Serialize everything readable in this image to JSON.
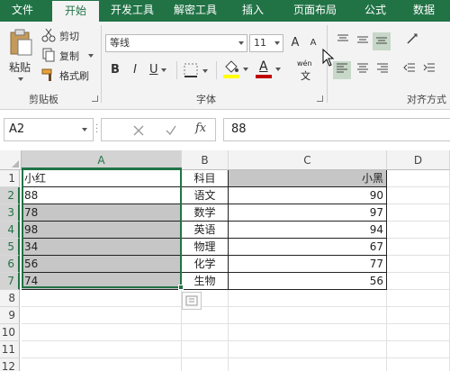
{
  "tabs": [
    {
      "label": "文件",
      "active": false
    },
    {
      "label": "开始",
      "active": true
    },
    {
      "label": "开发工具",
      "active": false
    },
    {
      "label": "解密工具",
      "active": false
    },
    {
      "label": "插入",
      "active": false
    },
    {
      "label": "页面布局",
      "active": false
    },
    {
      "label": "公式",
      "active": false
    },
    {
      "label": "数据",
      "active": false
    }
  ],
  "clipboard": {
    "paste": "粘贴",
    "cut": "剪切",
    "copy": "复制",
    "format_painter": "格式刷",
    "group": "剪贴板"
  },
  "font": {
    "name": "等线",
    "size": "11",
    "bold": "B",
    "italic": "I",
    "underline": "U",
    "grow": "A",
    "shrink": "A",
    "phonetic": "wén",
    "color_letter": "A",
    "group": "字体"
  },
  "alignment": {
    "group": "对齐方式"
  },
  "name_box": "A2",
  "formula_value": "88",
  "colors": {
    "accent": "#217346",
    "fill_yellow": "#ffff00",
    "font_red": "#c00000"
  },
  "columns": [
    "A",
    "B",
    "C",
    "D"
  ],
  "rows": [
    "1",
    "2",
    "3",
    "4",
    "5",
    "6",
    "7",
    "8",
    "9",
    "10",
    "11",
    "12"
  ],
  "table": [
    {
      "a": "小红",
      "b": "科目",
      "c": "小黑"
    },
    {
      "a": "88",
      "b": "语文",
      "c": "90"
    },
    {
      "a": "78",
      "b": "数学",
      "c": "97"
    },
    {
      "a": "98",
      "b": "英语",
      "c": "94"
    },
    {
      "a": "34",
      "b": "物理",
      "c": "67"
    },
    {
      "a": "56",
      "b": "化学",
      "c": "77"
    },
    {
      "a": "74",
      "b": "生物",
      "c": "56"
    }
  ],
  "icons": [
    "scissors-icon",
    "copy-icon",
    "brush-icon",
    "cancel-icon",
    "check-icon",
    "fx-icon",
    "fill-color-icon",
    "font-color-icon",
    "border-icon",
    "align-icon",
    "orientation-icon",
    "quick-analysis-icon"
  ]
}
